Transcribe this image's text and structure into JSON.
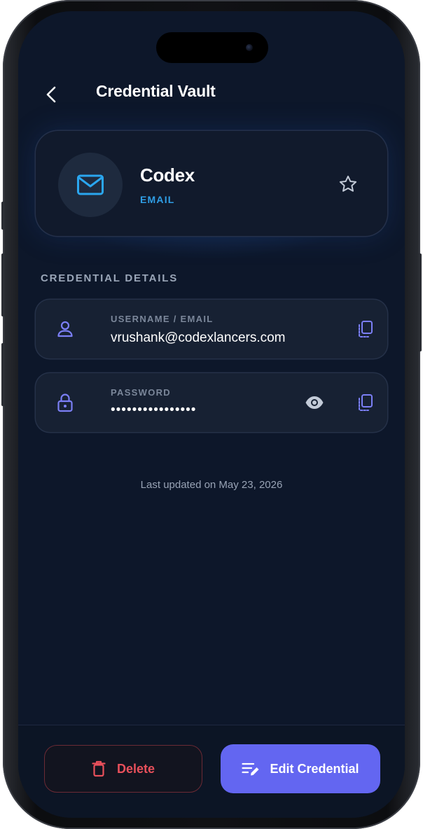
{
  "header": {
    "title": "Credential Vault"
  },
  "credential": {
    "name": "Codex",
    "type": "EMAIL"
  },
  "details": {
    "section_label": "CREDENTIAL DETAILS",
    "username": {
      "label": "USERNAME / EMAIL",
      "value": "vrushank@codexlancers.com"
    },
    "password": {
      "label": "PASSWORD",
      "value": "••••••••••••••••"
    }
  },
  "last_updated": "Last updated on May 23, 2026",
  "actions": {
    "delete_label": "Delete",
    "edit_label": "Edit Credential"
  },
  "colors": {
    "background": "#0d172a",
    "accent": "#6366f1",
    "type_badge": "#2f9ee6",
    "danger": "#e8505b"
  },
  "icons": {
    "back": "chevron-left-icon",
    "credential": "mail-icon",
    "favorite": "star-icon",
    "username": "user-icon",
    "password": "lock-icon",
    "reveal": "eye-icon",
    "copy": "copy-icon",
    "delete": "trash-icon",
    "edit": "edit-icon"
  }
}
